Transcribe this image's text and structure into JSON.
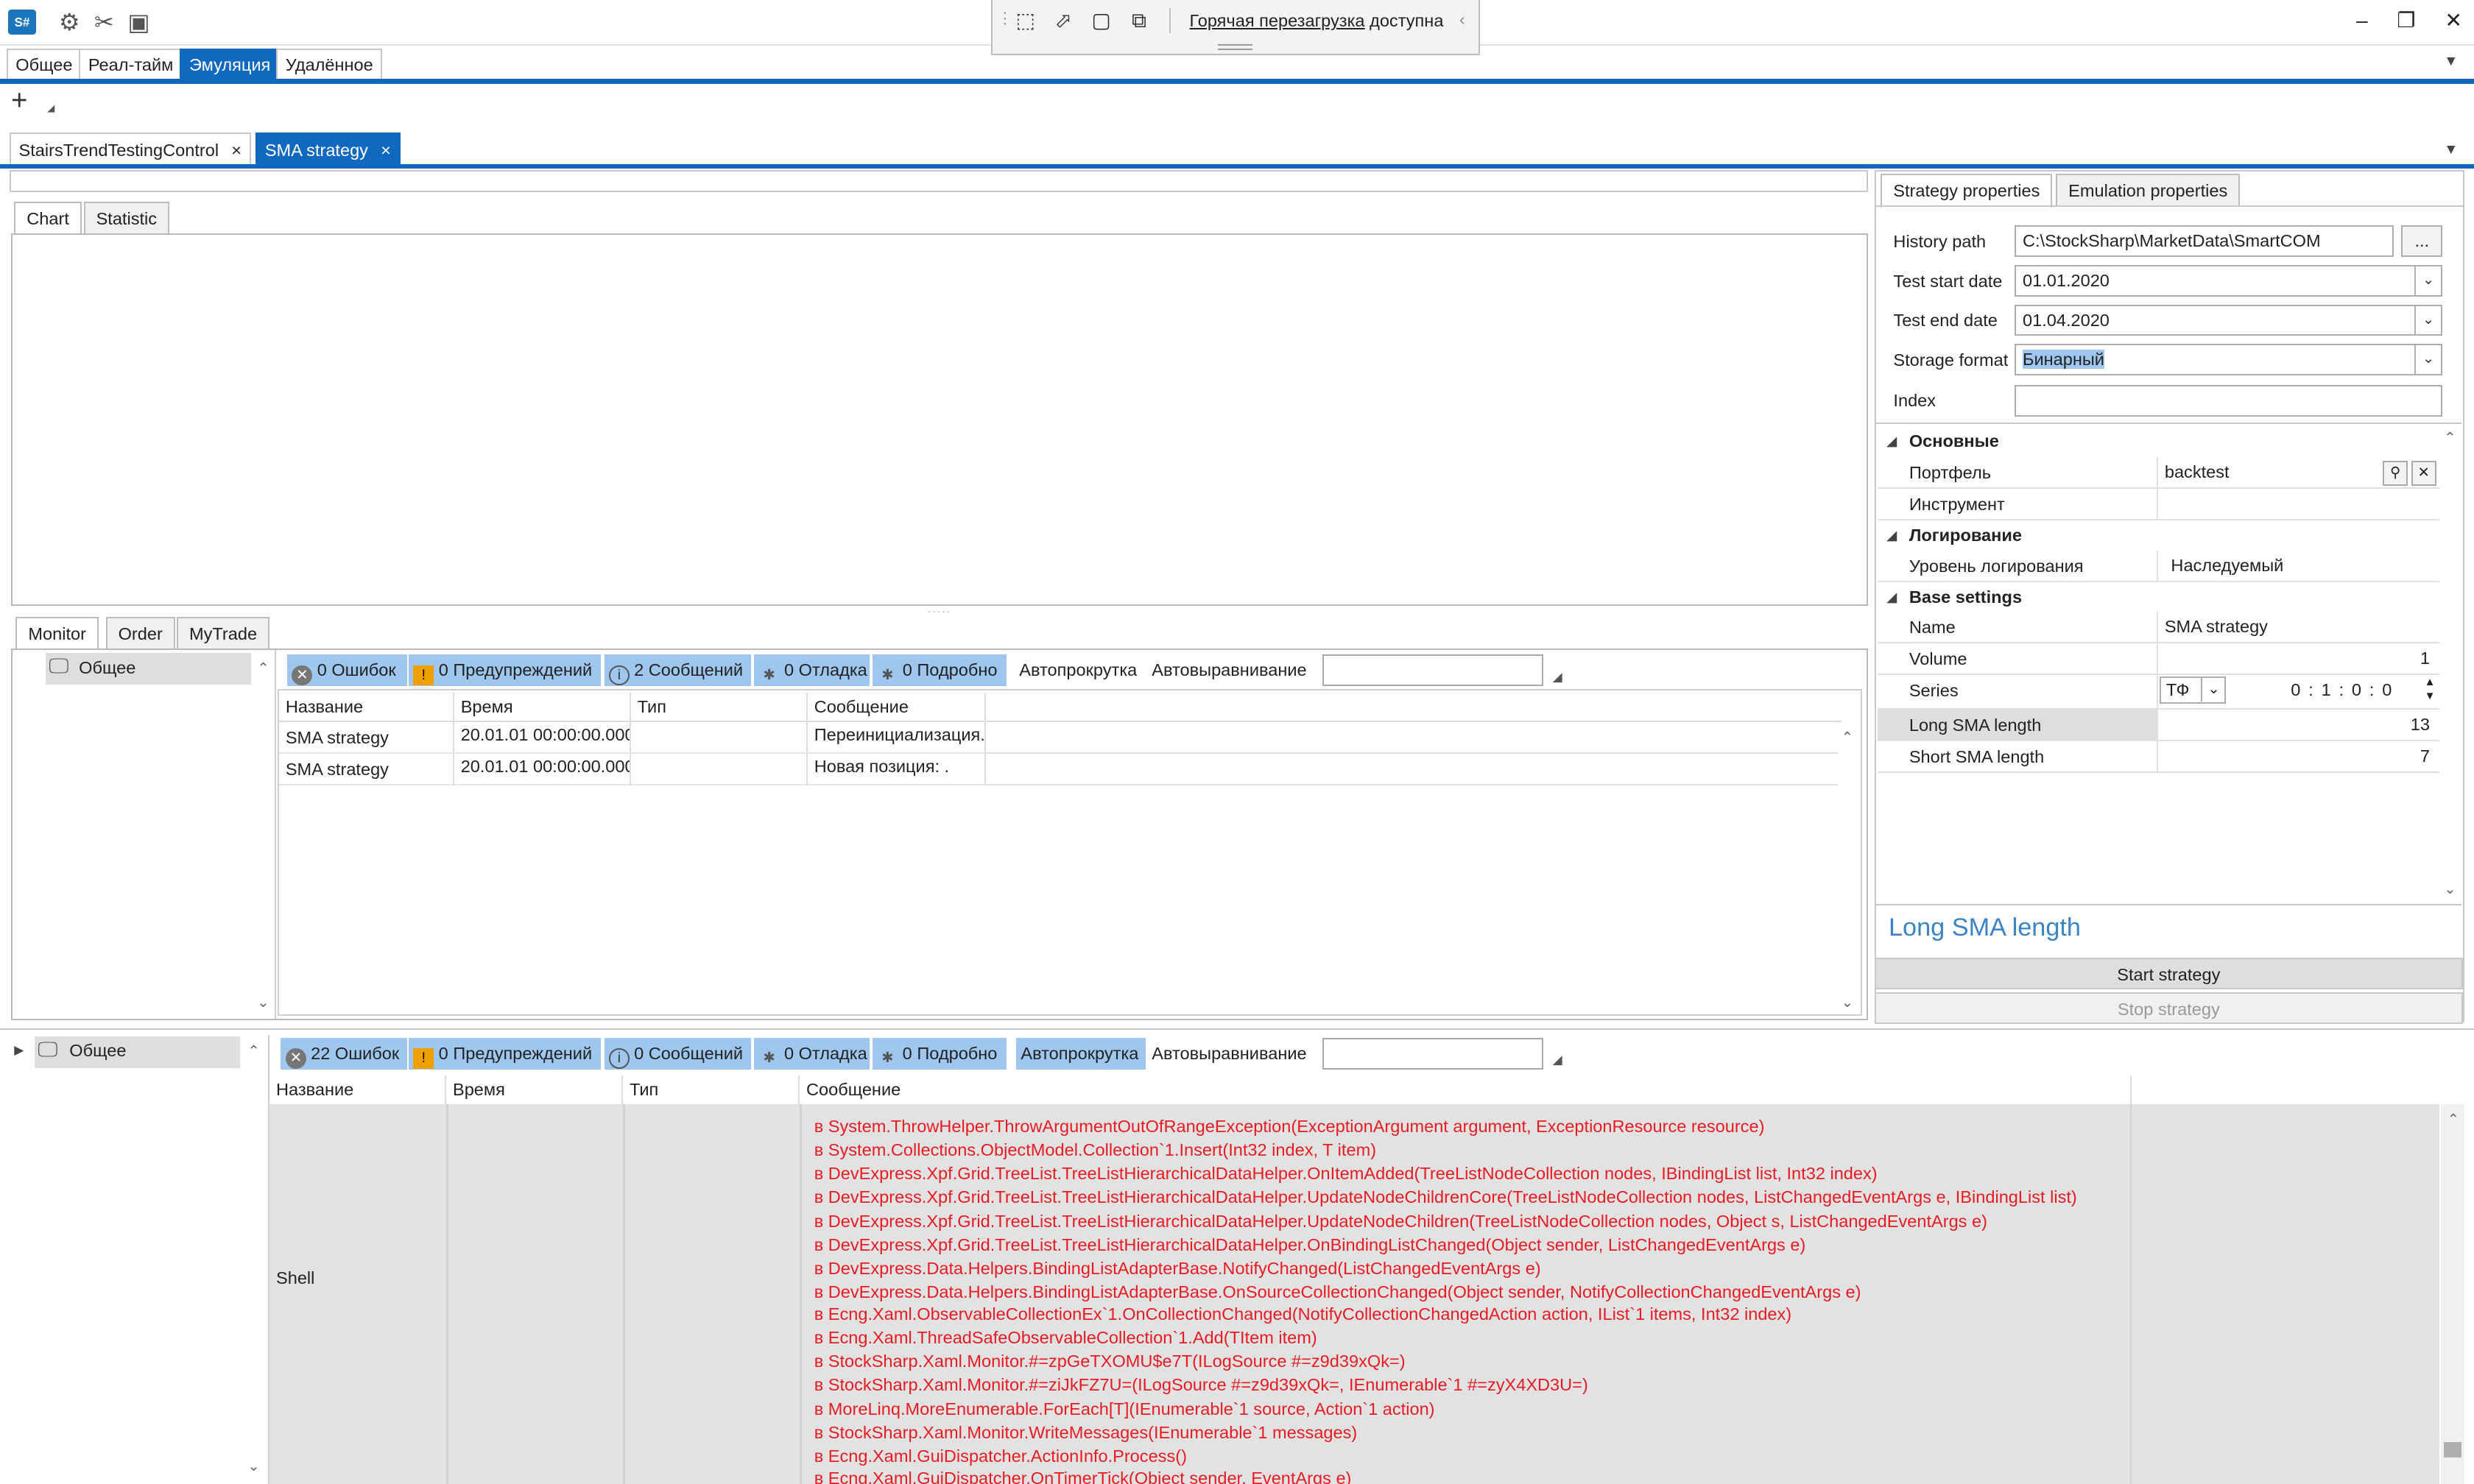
{
  "app": {
    "logo": "S#",
    "hot_reload_prefix": "Горячая перезагрузка",
    "hot_reload_suffix": " доступна"
  },
  "ribbon": {
    "tabs": [
      "Общее",
      "Реал-тайм",
      "Эмуляция",
      "Удалённое"
    ],
    "active": 2
  },
  "doc_tabs": [
    {
      "label": "StairsTrendTestingControl",
      "close": "×"
    },
    {
      "label": "SMA strategy",
      "close": "×"
    }
  ],
  "chart_tabs": [
    "Chart",
    "Statistic"
  ],
  "monitor_tabs": [
    "Monitor",
    "Order",
    "MyTrade"
  ],
  "monitor": {
    "tree_item": "Общее",
    "toolbar": {
      "errors": "0 Ошибок",
      "warnings": "0 Предупреждений",
      "messages": "2 Сообщений",
      "debug": "0 Отладка",
      "verbose": "0 Подробно",
      "autoscroll": "Автопрокрутка",
      "autoalign": "Автовыравнивание"
    },
    "columns": [
      "Название",
      "Время",
      "Тип",
      "Сообщение"
    ],
    "rows": [
      [
        "SMA strategy",
        "20.01.01 00:00:00.000",
        "",
        "Переинициализация."
      ],
      [
        "SMA strategy",
        "20.01.01 00:00:00.000",
        "",
        "Новая позиция: ."
      ]
    ]
  },
  "right": {
    "tabs": [
      "Strategy properties",
      "Emulation properties"
    ],
    "fields": {
      "history_label": "History path",
      "history_value": "C:\\StockSharp\\MarketData\\SmartCOM",
      "browse": "...",
      "start_label": "Test start date",
      "start_value": "01.01.2020",
      "end_label": "Test end date",
      "end_value": "01.04.2020",
      "storage_label": "Storage format",
      "storage_value": "Бинарный",
      "index_label": "Index",
      "index_value": ""
    },
    "grid": {
      "cat_main": "Основные",
      "portfolio_label": "Портфель",
      "portfolio_value": "backtest",
      "instrument_label": "Инструмент",
      "cat_log": "Логирование",
      "loglevel_label": "Уровень логирования",
      "loglevel_value": "Наследуемый",
      "cat_base": "Base settings",
      "name_label": "Name",
      "name_value": "SMA strategy",
      "volume_label": "Volume",
      "volume_value": "1",
      "series_label": "Series",
      "series_type": "ТФ",
      "series_value": "0 : 1 : 0 : 0",
      "long_label": "Long SMA length",
      "long_value": "13",
      "short_label": "Short SMA length",
      "short_value": "7"
    },
    "description": "Long SMA length",
    "start_button": "Start strategy",
    "stop_button": "Stop strategy"
  },
  "bottom": {
    "tree_item": "Общее",
    "toolbar": {
      "errors": "22 Ошибок",
      "warnings": "0 Предупреждений",
      "messages": "0 Сообщений",
      "debug": "0 Отладка",
      "verbose": "0 Подробно",
      "autoscroll": "Автопрокрутка",
      "autoalign": "Автовыравнивание"
    },
    "columns": [
      "Название",
      "Время",
      "Тип",
      "Сообщение"
    ],
    "row_name": "Shell",
    "stack": [
      "в System.ThrowHelper.ThrowArgumentOutOfRangeException(ExceptionArgument argument, ExceptionResource resource)",
      "в System.Collections.ObjectModel.Collection`1.Insert(Int32 index, T item)",
      "в DevExpress.Xpf.Grid.TreeList.TreeListHierarchicalDataHelper.OnItemAdded(TreeListNodeCollection nodes, IBindingList list, Int32 index)",
      "в DevExpress.Xpf.Grid.TreeList.TreeListHierarchicalDataHelper.UpdateNodeChildrenCore(TreeListNodeCollection nodes, ListChangedEventArgs e, IBindingList list)",
      "в DevExpress.Xpf.Grid.TreeList.TreeListHierarchicalDataHelper.UpdateNodeChildren(TreeListNodeCollection nodes, Object s, ListChangedEventArgs e)",
      "в DevExpress.Xpf.Grid.TreeList.TreeListHierarchicalDataHelper.OnBindingListChanged(Object sender, ListChangedEventArgs e)",
      "в DevExpress.Data.Helpers.BindingListAdapterBase.NotifyChanged(ListChangedEventArgs e)",
      "в DevExpress.Data.Helpers.BindingListAdapterBase.OnSourceCollectionChanged(Object sender, NotifyCollectionChangedEventArgs e)",
      "в Ecng.Xaml.ObservableCollectionEx`1.OnCollectionChanged(NotifyCollectionChangedAction action, IList`1 items, Int32 index)",
      "в Ecng.Xaml.ThreadSafeObservableCollection`1.Add(TItem item)",
      "в StockSharp.Xaml.Monitor.#=zpGeTXOMU$e7T(ILogSource #=z9d39xQk=)",
      "в StockSharp.Xaml.Monitor.#=ziJkFZ7U=(ILogSource #=z9d39xQk=, IEnumerable`1 #=zyX4XD3U=)",
      "в MoreLinq.MoreEnumerable.ForEach[T](IEnumerable`1 source, Action`1 action)",
      "в StockSharp.Xaml.Monitor.WriteMessages(IEnumerable`1 messages)",
      "в Ecng.Xaml.GuiDispatcher.ActionInfo.Process()",
      "в Ecng.Xaml.GuiDispatcher.OnTimerTick(Object sender, EventArgs e)"
    ]
  },
  "colors": {
    "accent": "#1068bf",
    "log_button": "#9ec6ee",
    "error_text": "#e81b23"
  }
}
